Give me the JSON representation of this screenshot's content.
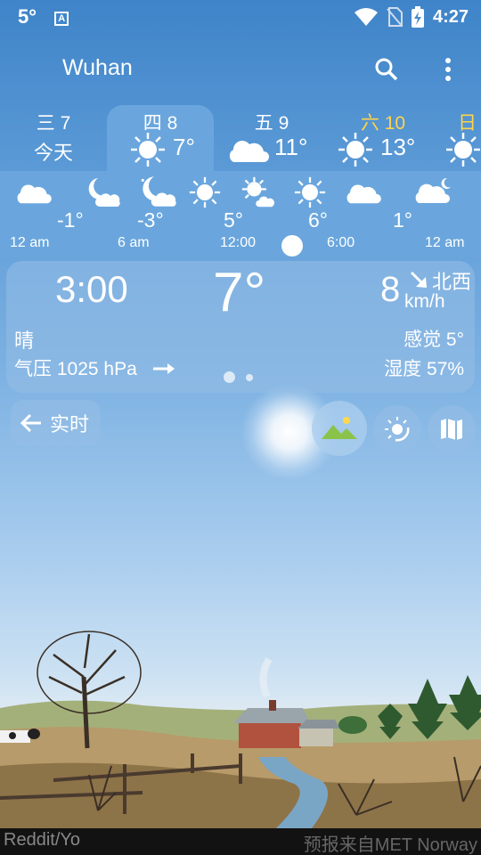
{
  "status_bar": {
    "temp": "5°",
    "time": "4:27"
  },
  "app_bar": {
    "city": "Wuhan"
  },
  "days": [
    {
      "label": "三 7",
      "sub": "今天"
    },
    {
      "label": "四 8",
      "temp": "7°",
      "icon": "sun-icon"
    },
    {
      "label": "五 9",
      "temp": "11°",
      "icon": "cloud-icon"
    },
    {
      "label": "六 10",
      "temp": "13°",
      "icon": "sun-icon"
    },
    {
      "label": "日",
      "icon": "sun-icon"
    }
  ],
  "hourly": {
    "temps": [
      "-1°",
      "-3°",
      "5°",
      "6°",
      "1°"
    ],
    "times": [
      "12 am",
      "6 am",
      "12:00",
      "6:00",
      "12 am"
    ]
  },
  "current": {
    "time": "3:00",
    "temp": "7°",
    "wind_speed": "8",
    "wind_unit": "km/h",
    "wind_dir": "北西",
    "condition": "晴",
    "feels_like": "感觉 5°",
    "pressure": "气压 1025 hPa",
    "humidity": "湿度 57%"
  },
  "controls": {
    "live_label": "实时"
  },
  "footer": {
    "credit": "Reddit/Yo",
    "source": "预报来自MET Norway"
  },
  "colors": {
    "sky_top": "#3f84c9",
    "strip": "#6aa6dd",
    "saturday": "#ffd44c"
  }
}
